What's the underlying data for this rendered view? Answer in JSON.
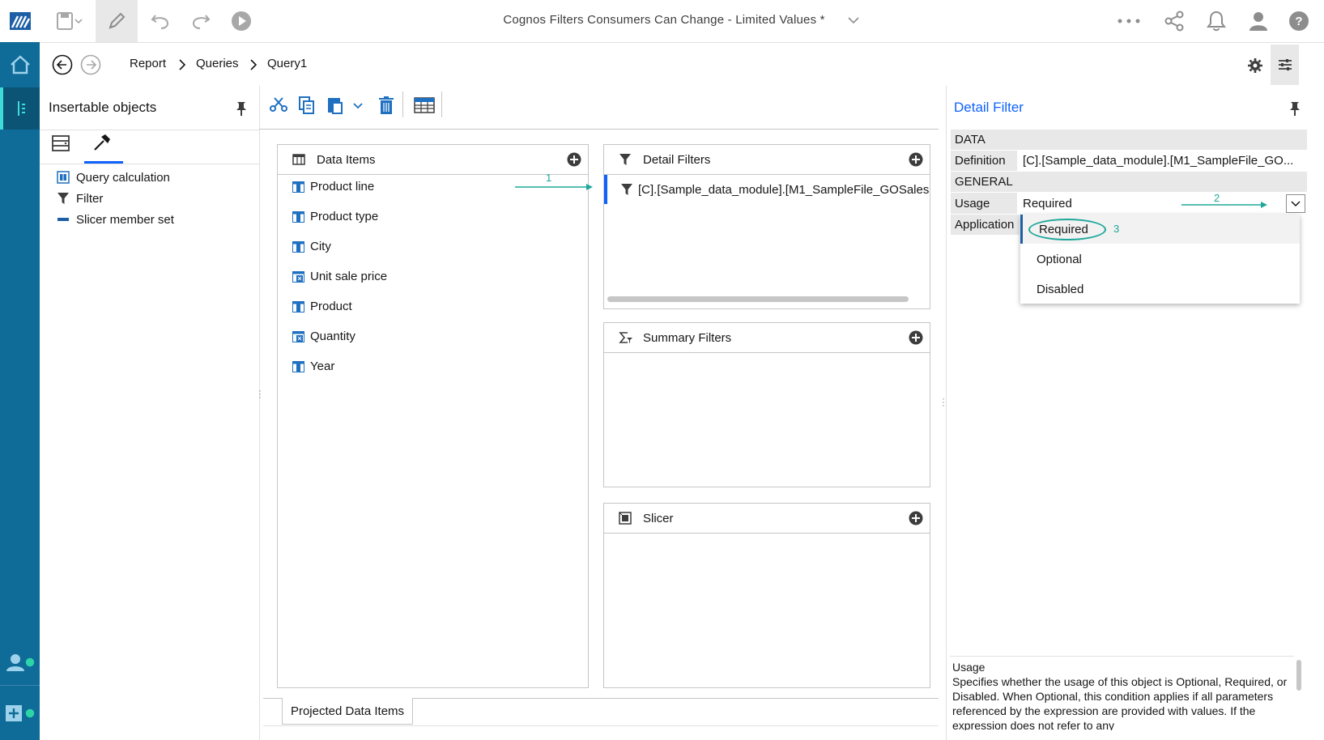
{
  "app": {
    "title": "Cognos Filters Consumers Can Change - Limited Values *"
  },
  "breadcrumb": [
    "Report",
    "Queries",
    "Query1"
  ],
  "left_panel": {
    "title": "Insertable objects",
    "items": [
      {
        "label": "Query calculation",
        "icon": "query-calculation-icon"
      },
      {
        "label": "Filter",
        "icon": "filter-icon"
      },
      {
        "label": "Slicer member set",
        "icon": "slicer-member-set-icon"
      }
    ]
  },
  "data_items": {
    "title": "Data Items",
    "items": [
      "Product line",
      "Product type",
      "City",
      "Unit sale price",
      "Product",
      "Quantity",
      "Year"
    ]
  },
  "detail_filters": {
    "title": "Detail Filters",
    "expression": "[C].[Sample_data_module].[M1_SampleFile_GOSales"
  },
  "summary_filters": {
    "title": "Summary Filters"
  },
  "slicer": {
    "title": "Slicer"
  },
  "bottom_tab": {
    "label": "Projected Data Items"
  },
  "right_panel": {
    "title": "Detail Filter",
    "sections": {
      "data": "DATA",
      "general": "GENERAL"
    },
    "properties": {
      "definition_label": "Definition",
      "definition_value": "[C].[Sample_data_module].[M1_SampleFile_GO...",
      "usage_label": "Usage",
      "usage_value": "Required",
      "application_label": "Application"
    },
    "dropdown_options": [
      "Required",
      "Optional",
      "Disabled"
    ],
    "help": {
      "title": "Usage",
      "text": "Specifies whether the usage of this object is Optional, Required, or Disabled. When Optional, this condition applies if all parameters referenced by the expression are provided with values. If the expression does not refer to any"
    }
  },
  "annotations": [
    "1",
    "2",
    "3"
  ],
  "colors": {
    "rail": "#0f6b97",
    "accent": "#0f62fe",
    "annotation": "#1fa89a",
    "icon_blue": "#1f70c1"
  }
}
